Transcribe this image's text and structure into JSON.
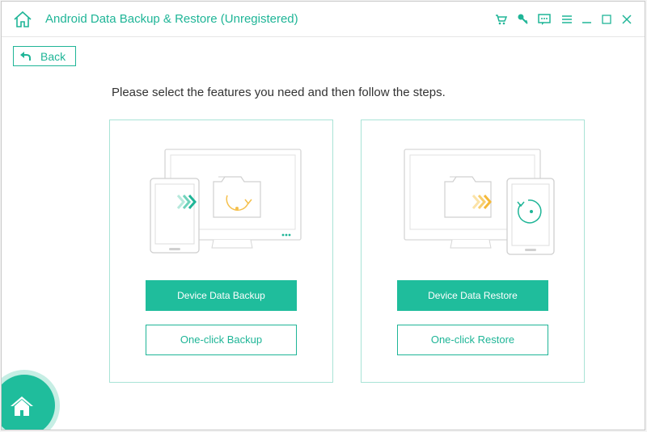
{
  "app": {
    "title": "Android Data Backup & Restore (Unregistered)",
    "accent": "#1fb597",
    "icons": [
      "home-icon",
      "cart-icon",
      "key-icon",
      "feedback-icon",
      "menu-icon",
      "minimize-icon",
      "maximize-icon",
      "close-icon"
    ]
  },
  "nav": {
    "back_label": "Back"
  },
  "main": {
    "instruction": "Please select the features you need and then follow the steps."
  },
  "cards": {
    "backup": {
      "primary_label": "Device Data Backup",
      "secondary_label": "One-click Backup"
    },
    "restore": {
      "primary_label": "Device Data Restore",
      "secondary_label": "One-click Restore"
    }
  }
}
